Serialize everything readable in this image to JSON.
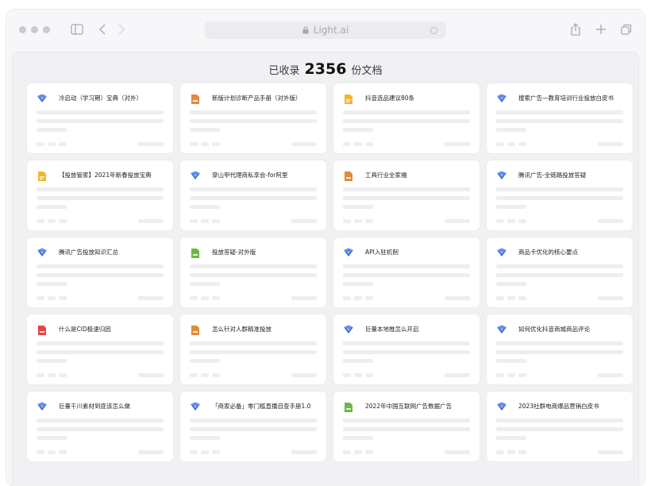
{
  "browser": {
    "address": "Light.ai"
  },
  "header": {
    "prefix": "已收录",
    "count": "2356",
    "suffix": "份文档"
  },
  "colors": {
    "word": "#2f6df6",
    "ppt": "#e08a3c",
    "excel": "#68b944",
    "pdf": "#e84141",
    "doc_yellow": "#f3b52c"
  },
  "documents": [
    {
      "title": "冷启动（学习期）宝典（对外）",
      "icon": "word-icon"
    },
    {
      "title": "新版计划诊断产品手册（对外版）",
      "icon": "ppt-file-icon"
    },
    {
      "title": "抖音选品建议80条",
      "icon": "yellow-file-icon"
    },
    {
      "title": "搜索广告—教育培训行业投放白皮书",
      "icon": "word-icon"
    },
    {
      "title": "【投放管家】2021年新春投放宝典",
      "icon": "yellow-file-icon"
    },
    {
      "title": "穿山甲代理商私享会-for阿里",
      "icon": "word-icon"
    },
    {
      "title": "工具行业全家福",
      "icon": "ppt-file-icon"
    },
    {
      "title": "腾讯广告-全链路投放答疑",
      "icon": "word-icon"
    },
    {
      "title": "腾讯广告投放知识汇总",
      "icon": "word-icon"
    },
    {
      "title": "投放答疑-对外版",
      "icon": "green-file-icon"
    },
    {
      "title": "API入驻机制",
      "icon": "word-icon"
    },
    {
      "title": "商品卡优化的核心要点",
      "icon": "word-icon"
    },
    {
      "title": "什么是CID极速归因",
      "icon": "pdf-file-icon"
    },
    {
      "title": "怎么针对人群精准投放",
      "icon": "ppt-file-icon"
    },
    {
      "title": "巨量本地推怎么开启",
      "icon": "word-icon"
    },
    {
      "title": "如何优化抖音商城商品评论",
      "icon": "word-icon"
    },
    {
      "title": "巨量千川素材到底该怎么做",
      "icon": "word-icon"
    },
    {
      "title": "「商家必备」零门槛直播自查手册1.0",
      "icon": "word-icon"
    },
    {
      "title": "2022年中国互联网广告数据广告",
      "icon": "green-file-icon"
    },
    {
      "title": "2023社群电商爆品营销白皮书",
      "icon": "word-icon"
    }
  ]
}
